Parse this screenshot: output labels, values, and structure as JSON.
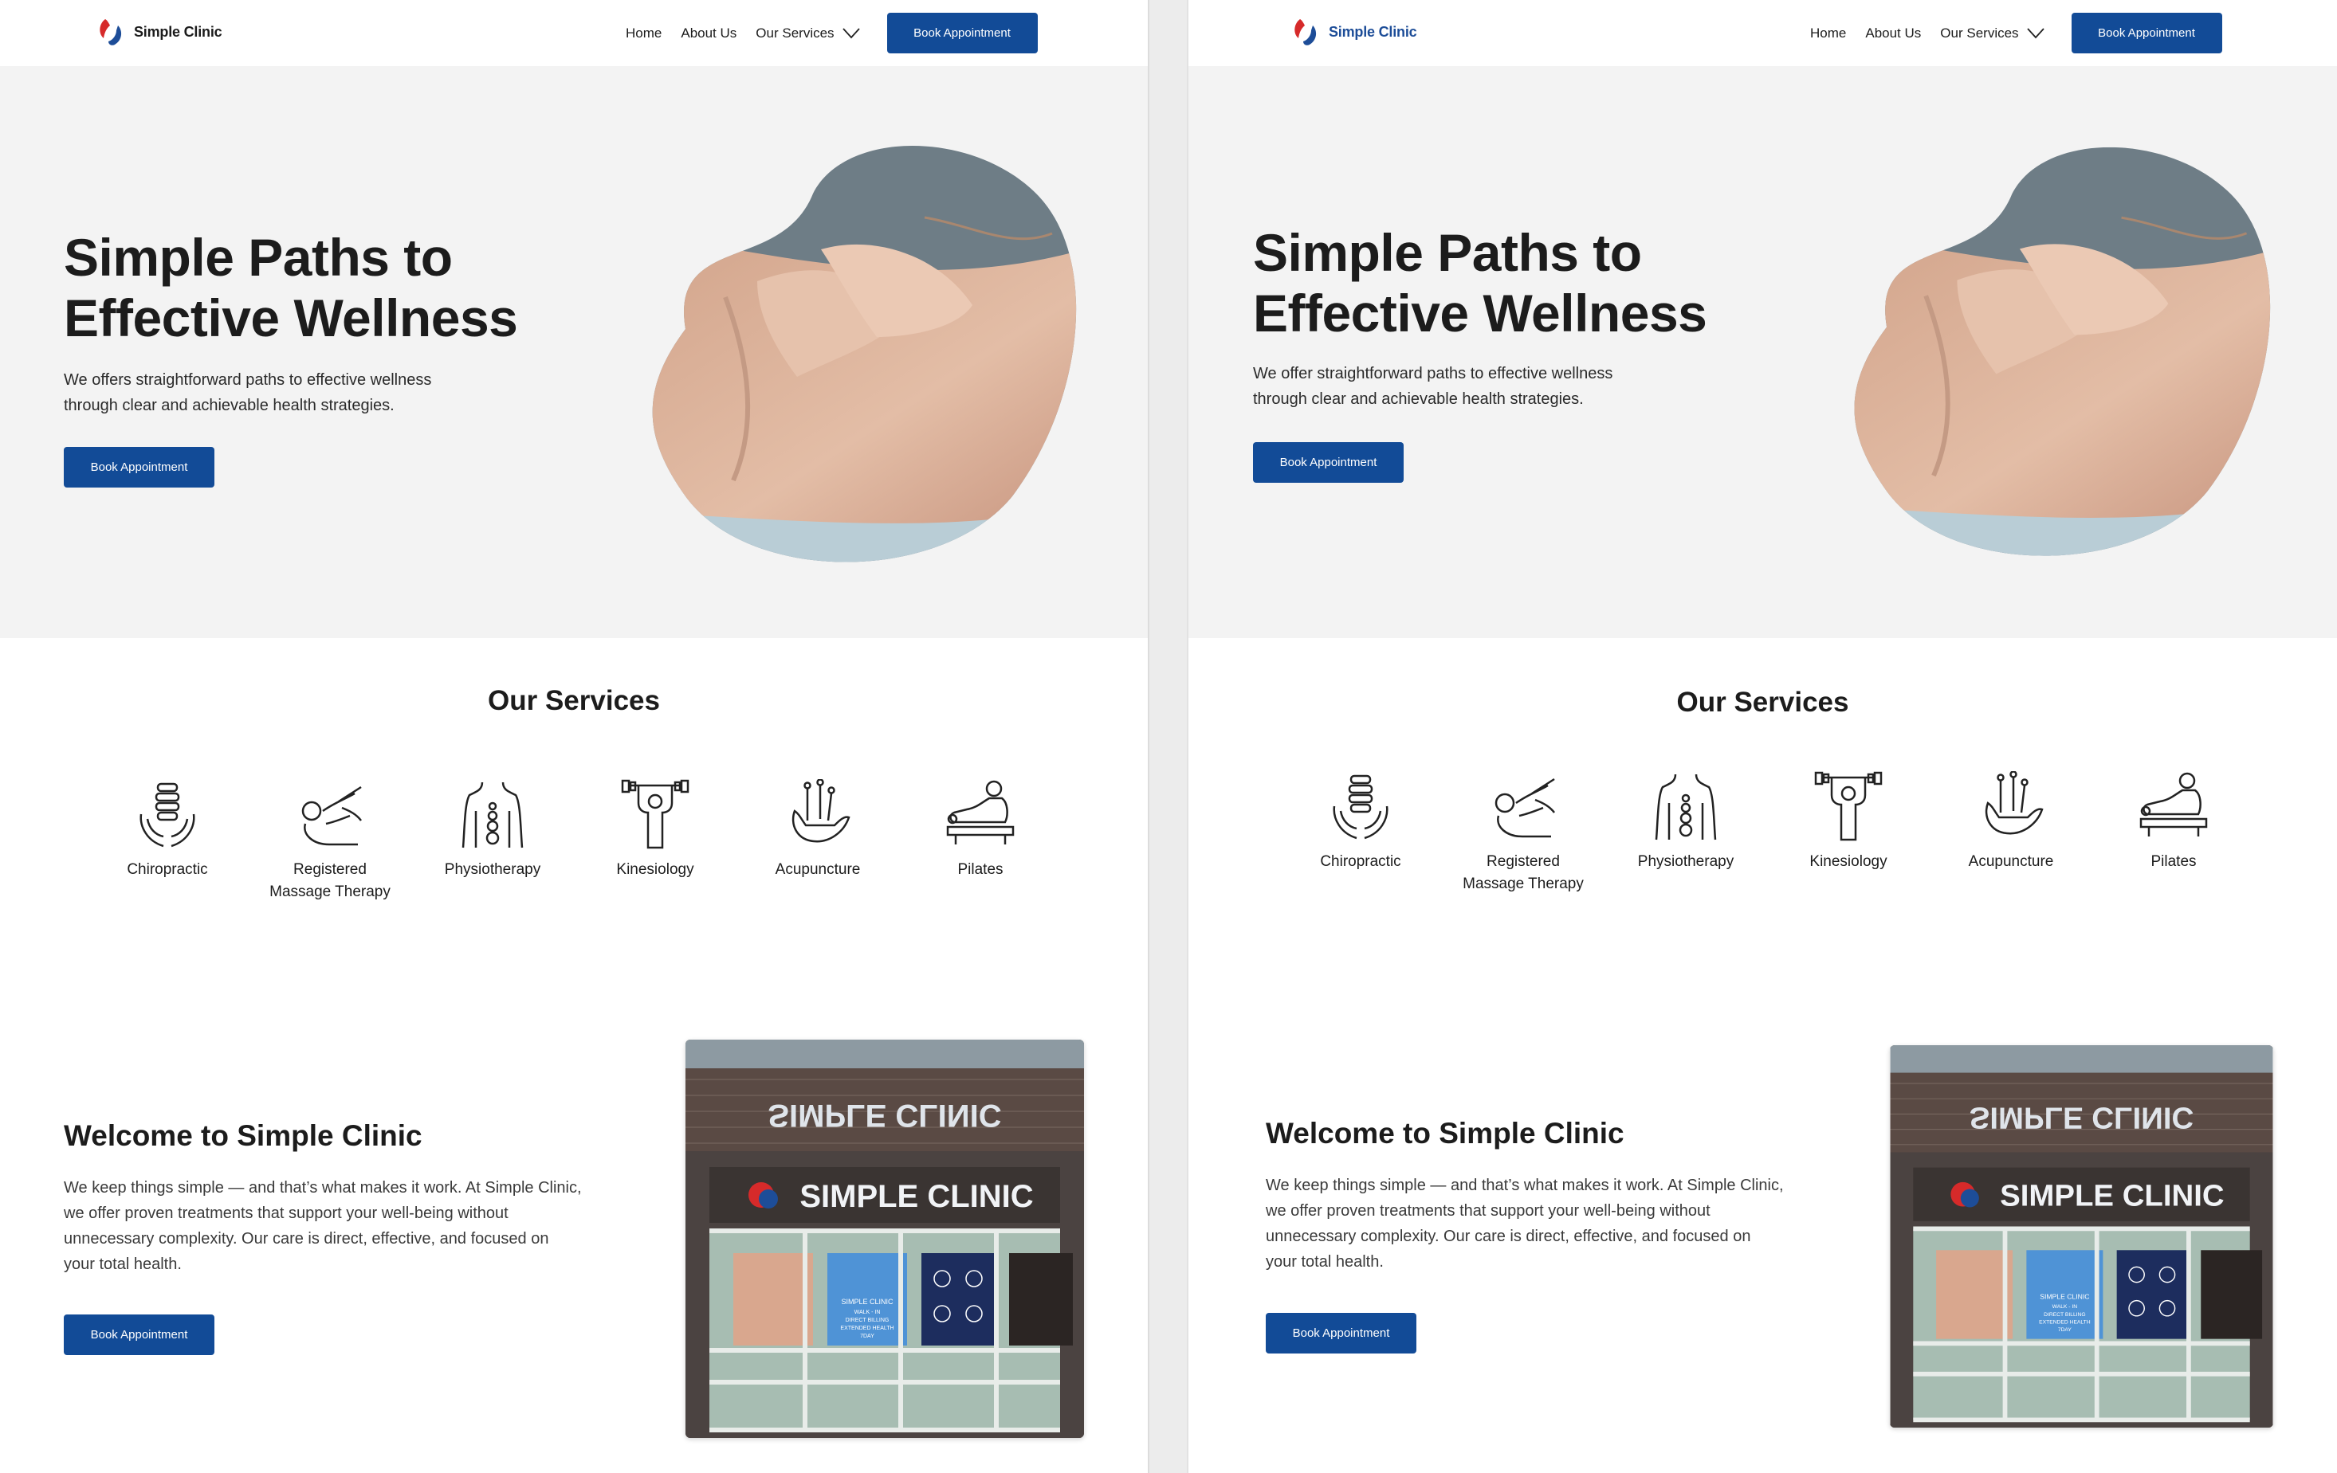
{
  "brand": {
    "name": "Simple Clinic",
    "primary_color": "#124b97",
    "accent_red": "#d62a2a",
    "accent_blue": "#1d4d98"
  },
  "nav": {
    "home": "Home",
    "about": "About Us",
    "services": "Our Services",
    "book": "Book Appointment"
  },
  "left": {
    "hero": {
      "title_line1": "Simple Paths to",
      "title_line2": "Effective Wellness",
      "subtitle_line1": "We offers straightforward paths to effective wellness",
      "subtitle_line2": "through clear and achievable health strategies.",
      "cta": "Book Appointment"
    }
  },
  "right": {
    "hero": {
      "title_line1": "Simple Paths to",
      "title_line2": "Effective Wellness",
      "subtitle_line1": "We offer straightforward paths to effective wellness",
      "subtitle_line2": "through clear and achievable health strategies.",
      "cta": "Book Appointment"
    }
  },
  "services": {
    "title": "Our Services",
    "items": [
      {
        "label_line1": "Chiropractic",
        "label_line2": "",
        "icon": "spine-hands-icon"
      },
      {
        "label_line1": "Registered",
        "label_line2": "Massage Therapy",
        "icon": "massage-icon"
      },
      {
        "label_line1": "Physiotherapy",
        "label_line2": "",
        "icon": "torso-icon"
      },
      {
        "label_line1": "Kinesiology",
        "label_line2": "",
        "icon": "weightlifter-icon"
      },
      {
        "label_line1": "Acupuncture",
        "label_line2": "",
        "icon": "needles-hand-icon"
      },
      {
        "label_line1": "Pilates",
        "label_line2": "",
        "icon": "reformer-icon"
      }
    ]
  },
  "welcome": {
    "title": "Welcome to Simple Clinic",
    "body_lines": [
      "We keep things simple — and that’s what makes it work. At Simple Clinic,",
      "we offer proven treatments that support your well-being without",
      "unnecessary complexity. Our care is direct, effective, and focused on",
      "your total health."
    ],
    "cta": "Book Appointment",
    "sign_text": "SIMPLE CLINIC",
    "sign_reflection": "SIMPLE CLINIC",
    "poster_text_line1": "SIMPLE CLINIC",
    "poster_text_line2": "WALK - IN",
    "poster_text_line3": "DIRECT BILLING",
    "poster_text_line4": "EXTENDED HEALTH",
    "poster_text_line5": "7DAY"
  }
}
